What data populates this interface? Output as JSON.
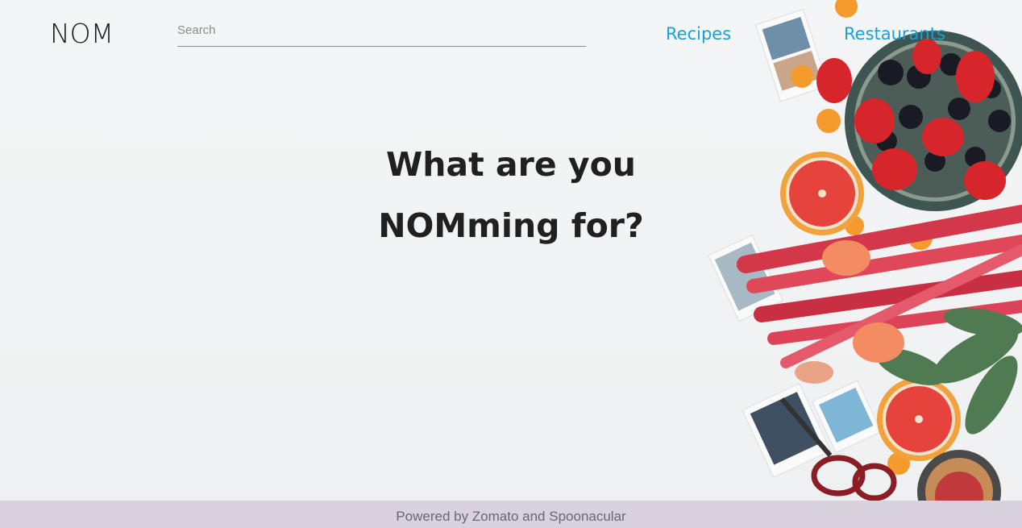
{
  "header": {
    "logo": "NOM",
    "search": {
      "placeholder": "Search",
      "value": ""
    },
    "nav": {
      "recipes": "Recipes",
      "restaurants": "Restaurants"
    }
  },
  "hero": {
    "line1": "What are you",
    "line2": "NOMming for?"
  },
  "footer": {
    "text": "Powered by Zomato and Spoonacular"
  },
  "colors": {
    "accent": "#1aa0d6",
    "footer_bg": "#d9d2de",
    "text": "#202020"
  }
}
